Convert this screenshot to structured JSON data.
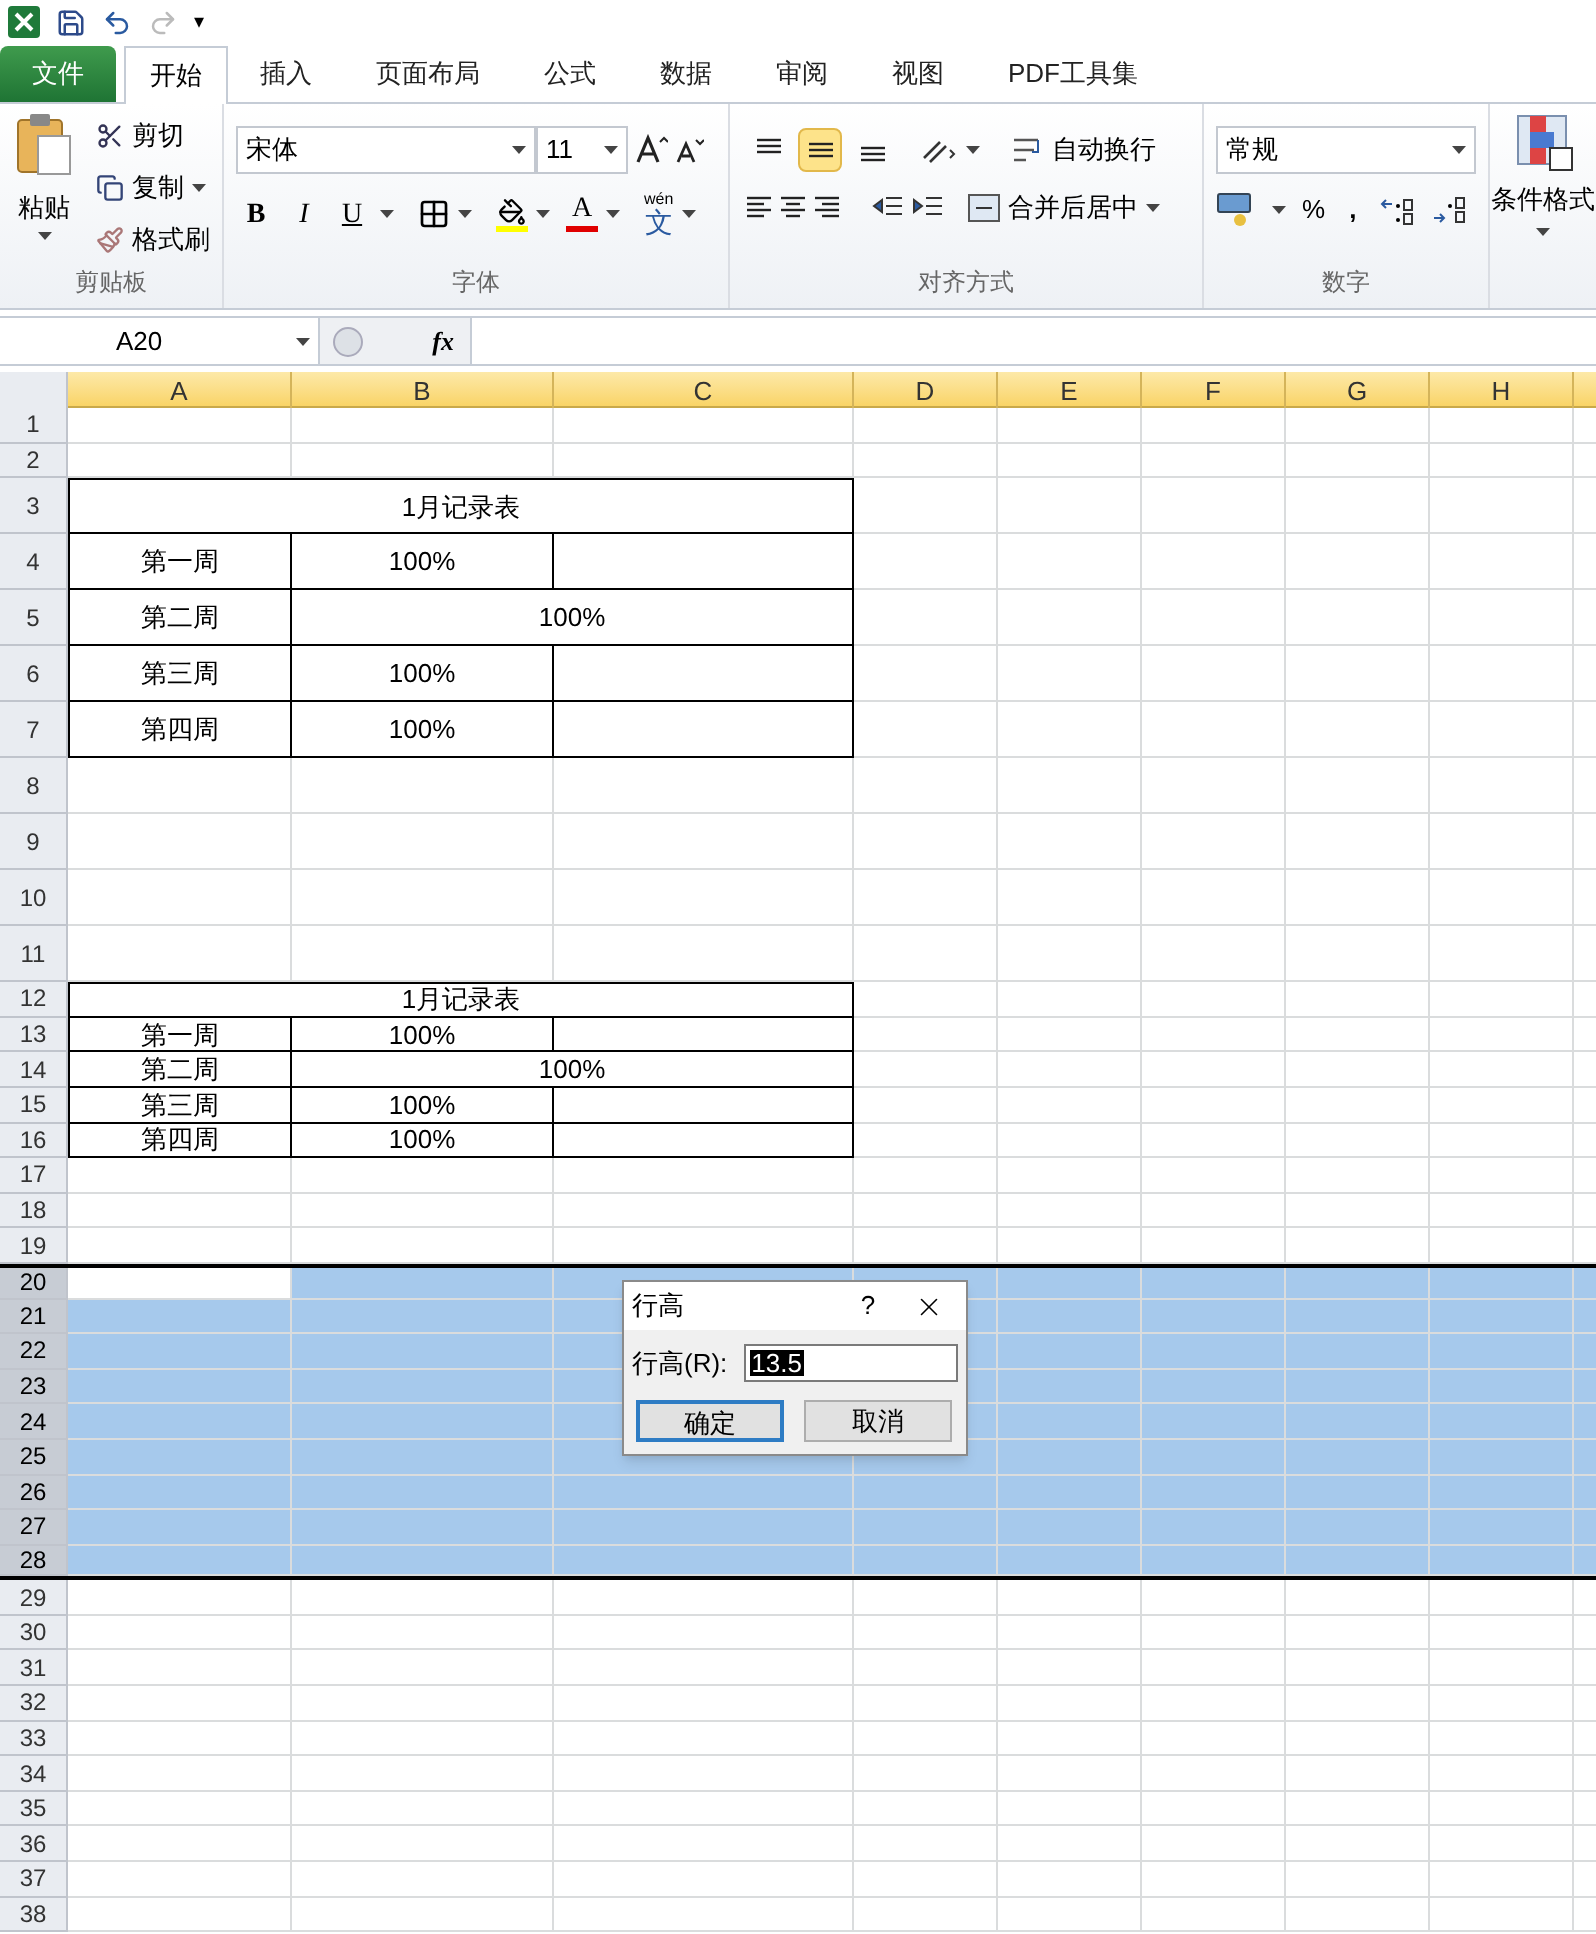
{
  "quick_access": {
    "more": "▾"
  },
  "tabs": [
    {
      "label": "文件",
      "kind": "file",
      "selected": false
    },
    {
      "label": "开始",
      "kind": "tab",
      "selected": true
    },
    {
      "label": "插入",
      "kind": "tab",
      "selected": false
    },
    {
      "label": "页面布局",
      "kind": "tab",
      "selected": false
    },
    {
      "label": "公式",
      "kind": "tab",
      "selected": false
    },
    {
      "label": "数据",
      "kind": "tab",
      "selected": false
    },
    {
      "label": "审阅",
      "kind": "tab",
      "selected": false
    },
    {
      "label": "视图",
      "kind": "tab",
      "selected": false
    },
    {
      "label": "PDF工具集",
      "kind": "tab",
      "selected": false
    }
  ],
  "ribbon": {
    "clipboard": {
      "paste": "粘贴",
      "cut": "剪切",
      "copy": "复制",
      "format_painter": "格式刷",
      "label": "剪贴板"
    },
    "font": {
      "name": "宋体",
      "size": "11",
      "bold": "B",
      "italic": "I",
      "underline": "U",
      "font_color": "A",
      "phonetic_top": "wén",
      "phonetic": "文",
      "label": "字体"
    },
    "alignment": {
      "vertical": [
        {
          "kind": "top",
          "selected": false
        },
        {
          "kind": "middle",
          "selected": true
        },
        {
          "kind": "bottom",
          "selected": false
        }
      ],
      "wrap": "自动换行",
      "merge": "合并后居中",
      "label": "对齐方式"
    },
    "number": {
      "format": "常规",
      "percent": "%",
      "comma": ",",
      "label": "数字"
    },
    "styles": {
      "conditional": "条件格式"
    }
  },
  "formula_bar": {
    "name_box": "A20",
    "fx": "fx"
  },
  "sheet": {
    "columns": [
      "A",
      "B",
      "C",
      "D",
      "E",
      "F",
      "G",
      "H"
    ],
    "rows": [
      {
        "n": "1",
        "kind": "normal",
        "selected": false,
        "bordered": false,
        "cells": []
      },
      {
        "n": "2",
        "kind": "normal",
        "selected": false,
        "bordered": false,
        "cells": []
      },
      {
        "n": "3",
        "kind": "tall",
        "selected": false,
        "bordered": true,
        "cells": [
          {
            "text": "1月记录表",
            "merged": true
          }
        ]
      },
      {
        "n": "4",
        "kind": "tall",
        "selected": false,
        "bordered": true,
        "cells": [
          {
            "text": "第一周",
            "merged": false
          },
          {
            "text": "100%",
            "merged": false
          }
        ]
      },
      {
        "n": "5",
        "kind": "tall",
        "selected": false,
        "bordered": true,
        "cells": [
          {
            "text": "第二周",
            "merged": false
          },
          {
            "text": "100%",
            "merged": true
          }
        ]
      },
      {
        "n": "6",
        "kind": "tall",
        "selected": false,
        "bordered": true,
        "cells": [
          {
            "text": "第三周",
            "merged": false
          },
          {
            "text": "100%",
            "merged": false
          }
        ]
      },
      {
        "n": "7",
        "kind": "tall",
        "selected": false,
        "bordered": true,
        "cells": [
          {
            "text": "第四周",
            "merged": false
          },
          {
            "text": "100%",
            "merged": false
          }
        ]
      },
      {
        "n": "8",
        "kind": "tall",
        "selected": false,
        "bordered": false,
        "cells": []
      },
      {
        "n": "9",
        "kind": "tall",
        "selected": false,
        "bordered": false,
        "cells": []
      },
      {
        "n": "10",
        "kind": "tall",
        "selected": false,
        "bordered": false,
        "cells": []
      },
      {
        "n": "11",
        "kind": "tall",
        "selected": false,
        "bordered": false,
        "cells": []
      },
      {
        "n": "12",
        "kind": "normal",
        "selected": false,
        "bordered": true,
        "cells": [
          {
            "text": "1月记录表",
            "merged": true
          }
        ]
      },
      {
        "n": "13",
        "kind": "normal",
        "selected": false,
        "bordered": true,
        "cells": [
          {
            "text": "第一周",
            "merged": false
          },
          {
            "text": "100%",
            "merged": false
          }
        ]
      },
      {
        "n": "14",
        "kind": "normal",
        "selected": false,
        "bordered": true,
        "cells": [
          {
            "text": "第二周",
            "merged": false
          },
          {
            "text": "100%",
            "merged": true
          }
        ]
      },
      {
        "n": "15",
        "kind": "normal",
        "selected": false,
        "bordered": true,
        "cells": [
          {
            "text": "第三周",
            "merged": false
          },
          {
            "text": "100%",
            "merged": false
          }
        ]
      },
      {
        "n": "16",
        "kind": "normal",
        "selected": false,
        "bordered": true,
        "cells": [
          {
            "text": "第四周",
            "merged": false
          },
          {
            "text": "100%",
            "merged": false
          }
        ]
      },
      {
        "n": "17",
        "kind": "normal",
        "selected": false,
        "bordered": false,
        "cells": []
      },
      {
        "n": "18",
        "kind": "normal",
        "selected": false,
        "bordered": false,
        "cells": []
      },
      {
        "n": "19",
        "kind": "normal",
        "selected": false,
        "bordered": false,
        "cells": []
      },
      {
        "n": "20",
        "kind": "normal",
        "selected": true,
        "bordered": false,
        "cells": []
      },
      {
        "n": "21",
        "kind": "normal",
        "selected": true,
        "bordered": false,
        "cells": []
      },
      {
        "n": "22",
        "kind": "normal",
        "selected": true,
        "bordered": false,
        "cells": []
      },
      {
        "n": "23",
        "kind": "normal",
        "selected": true,
        "bordered": false,
        "cells": []
      },
      {
        "n": "24",
        "kind": "normal",
        "selected": true,
        "bordered": false,
        "cells": []
      },
      {
        "n": "25",
        "kind": "normal",
        "selected": true,
        "bordered": false,
        "cells": []
      },
      {
        "n": "26",
        "kind": "normal",
        "selected": true,
        "bordered": false,
        "cells": []
      },
      {
        "n": "27",
        "kind": "normal",
        "selected": true,
        "bordered": false,
        "cells": []
      },
      {
        "n": "28",
        "kind": "normal",
        "selected": true,
        "bordered": false,
        "cells": []
      },
      {
        "n": "29",
        "kind": "normal",
        "selected": false,
        "bordered": false,
        "cells": []
      },
      {
        "n": "30",
        "kind": "normal",
        "selected": false,
        "bordered": false,
        "cells": []
      },
      {
        "n": "31",
        "kind": "normal",
        "selected": false,
        "bordered": false,
        "cells": []
      },
      {
        "n": "32",
        "kind": "normal",
        "selected": false,
        "bordered": false,
        "cells": []
      },
      {
        "n": "33",
        "kind": "normal",
        "selected": false,
        "bordered": false,
        "cells": []
      },
      {
        "n": "34",
        "kind": "normal",
        "selected": false,
        "bordered": false,
        "cells": []
      },
      {
        "n": "35",
        "kind": "normal",
        "selected": false,
        "bordered": false,
        "cells": []
      },
      {
        "n": "36",
        "kind": "normal",
        "selected": false,
        "bordered": false,
        "cells": []
      },
      {
        "n": "37",
        "kind": "normal",
        "selected": false,
        "bordered": false,
        "cells": []
      },
      {
        "n": "38",
        "kind": "normal",
        "selected": false,
        "bordered": false,
        "cells": []
      }
    ]
  },
  "dialog": {
    "title": "行高",
    "help": "?",
    "field_label": "行高(R):",
    "value": "13.5",
    "ok": "确定",
    "cancel": "取消"
  }
}
